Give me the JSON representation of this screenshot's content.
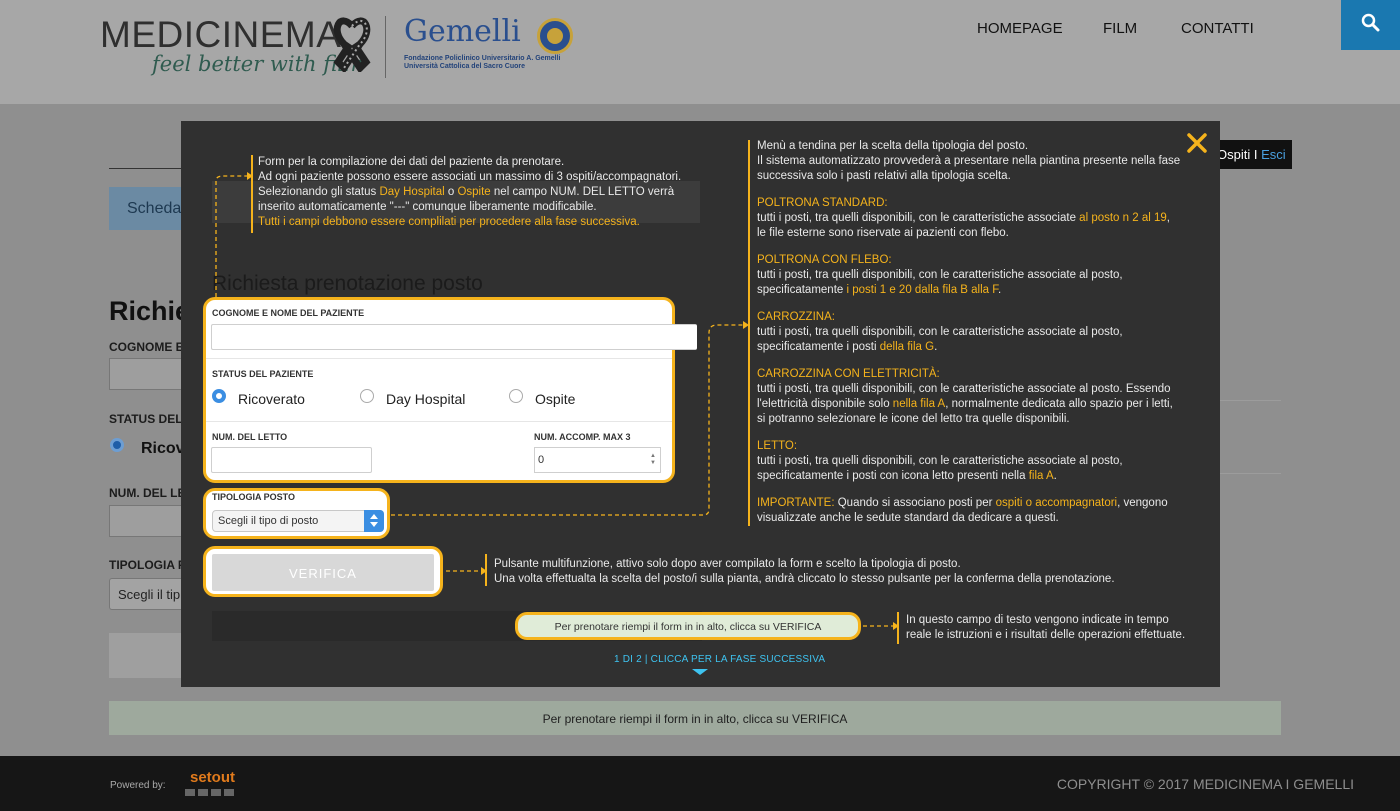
{
  "header": {
    "logo_main": "MEDICINEMA",
    "logo_tagline": "feel better with film",
    "partner_name": "Gemelli",
    "partner_sub_1": "Fondazione Policlinico Universitario A. Gemelli",
    "partner_sub_2": "Università Cattolica del Sacro Cuore",
    "nav": [
      "HOMEPAGE",
      "FILM",
      "CONTATTI"
    ],
    "search_icon": "search-icon",
    "accent": "#1a78b0"
  },
  "background_page": {
    "tab_label": "Scheda",
    "user_guest": "Ospiti I ",
    "user_logout": "Esci",
    "title": "Richie",
    "label_name": "COGNOME E N",
    "label_status": "STATUS DEL P",
    "radio_label": "Ricove",
    "label_bed": "NUM. DEL LET",
    "label_type": "TIPOLOGIA PO",
    "select_value": "Scegli il tip",
    "status_message": "Per prenotare riempi il form in in alto, clicca su VERIFICA"
  },
  "footer": {
    "powered": "Powered by:",
    "setout": "setout",
    "copyright": "COPYRIGHT © 2017 MEDICINEMA I GEMELLI"
  },
  "overlay": {
    "accent": "#f5b31c",
    "ghost_title": "Richiesta prenotazione posto",
    "annot_form": {
      "l1": "Form per la compilazione dei dati del paziente da prenotare.",
      "l2": "Ad ogni paziente possono essere associati un massimo di 3 ospiti/accompagnatori.",
      "l3a": "Selezionando gli status ",
      "l3b": "Day Hospital",
      "l3c": " o ",
      "l3d": "Ospite",
      "l3e": " nel campo NUM. DEL LETTO verrà",
      "l4": "inserito automaticamente \"---\" comunque liberamente modificabile.",
      "l5": "Tutti i campi debbono essere complilati per procedere alla fase successiva."
    },
    "annot_menu": {
      "intro1": "Menù a tendina per la scelta della tipologia del posto.",
      "intro2": "Il sistema automatizzato provvederà a presentare nella piantina presente nella fase",
      "intro3": "successiva solo i pasti relativi alla tipologia scelta.",
      "s1_head": "POLTRONA STANDARD:",
      "s1_a": "tutti i posti, tra quelli disponibili, con le caratteristiche associate ",
      "s1_b": "al posto n 2 al 19",
      "s1_c": ",",
      "s1_d": "le file esterne sono riservate ai pazienti con flebo.",
      "s2_head": "POLTRONA CON FLEBO:",
      "s2_a": "tutti i posti, tra quelli disponibili, con le caratteristiche associate al posto,",
      "s2_b": "specificatamente ",
      "s2_c": "i posti 1 e 20 dalla fila B alla F",
      "s2_d": ".",
      "s3_head": "CARROZZINA:",
      "s3_a": "tutti i posti, tra quelli disponibili, con le caratteristiche associate al posto,",
      "s3_b": "specificatamente i posti ",
      "s3_c": "della fila G",
      "s3_d": ".",
      "s4_head": "CARROZZINA CON ELETTRICITÀ:",
      "s4_a": "tutti i posti, tra quelli disponibili, con le caratteristiche associate al posto. Essendo",
      "s4_b": "l'elettricità disponibile solo ",
      "s4_c": "nella fila A",
      "s4_d": ", normalmente dedicata allo spazio per i letti,",
      "s4_e": "si potranno selezionare le icone del letto tra quelle disponibili.",
      "s5_head": "LETTO:",
      "s5_a": "tutti i posti, tra quelli disponibili, con le caratteristiche associate al posto,",
      "s5_b": "specificatamente i posti con icona letto presenti nella ",
      "s5_c": "fila A",
      "s5_d": ".",
      "s6_head": "IMPORTANTE:",
      "s6_a": " Quando si associano posti per ",
      "s6_b": "ospiti o accompagnatori",
      "s6_c": ", vengono",
      "s6_d": "visualizzate anche le sedute standard da dedicare a questi."
    },
    "annot_button": {
      "l1": "Pulsante multifunzione, attivo solo dopo aver compilato la form e scelto la tipologia di posto.",
      "l2": "Una volta effettualta la scelta del posto/i sulla pianta, andrà cliccato lo stesso pulsante per la conferma della prenotazione."
    },
    "annot_message": {
      "l1": "In questo campo di testo vengono indicate in tempo",
      "l2": "reale le istruzioni e i risultati delle operazioni effettuate."
    },
    "form": {
      "name_label": "COGNOME E NOME DEL PAZIENTE",
      "name_value": "",
      "status_label": "STATUS DEL PAZIENTE",
      "status_options": [
        "Ricoverato",
        "Day Hospital",
        "Ospite"
      ],
      "status_selected": "Ricoverato",
      "bed_label": "NUM. DEL LETTO",
      "bed_value": "",
      "guests_label": "NUM. ACCOMP. MAX 3",
      "guests_value": "0",
      "type_label": "TIPOLOGIA POSTO",
      "type_value": "Scegli il tipo di posto",
      "verify_label": "VERIFICA",
      "message": "Per prenotare riempi il form in in alto, clicca su VERIFICA"
    },
    "pager": {
      "step": "1 DI 2",
      "hint": "CLICCA PER LA FASE SUCCESSIVA"
    }
  }
}
